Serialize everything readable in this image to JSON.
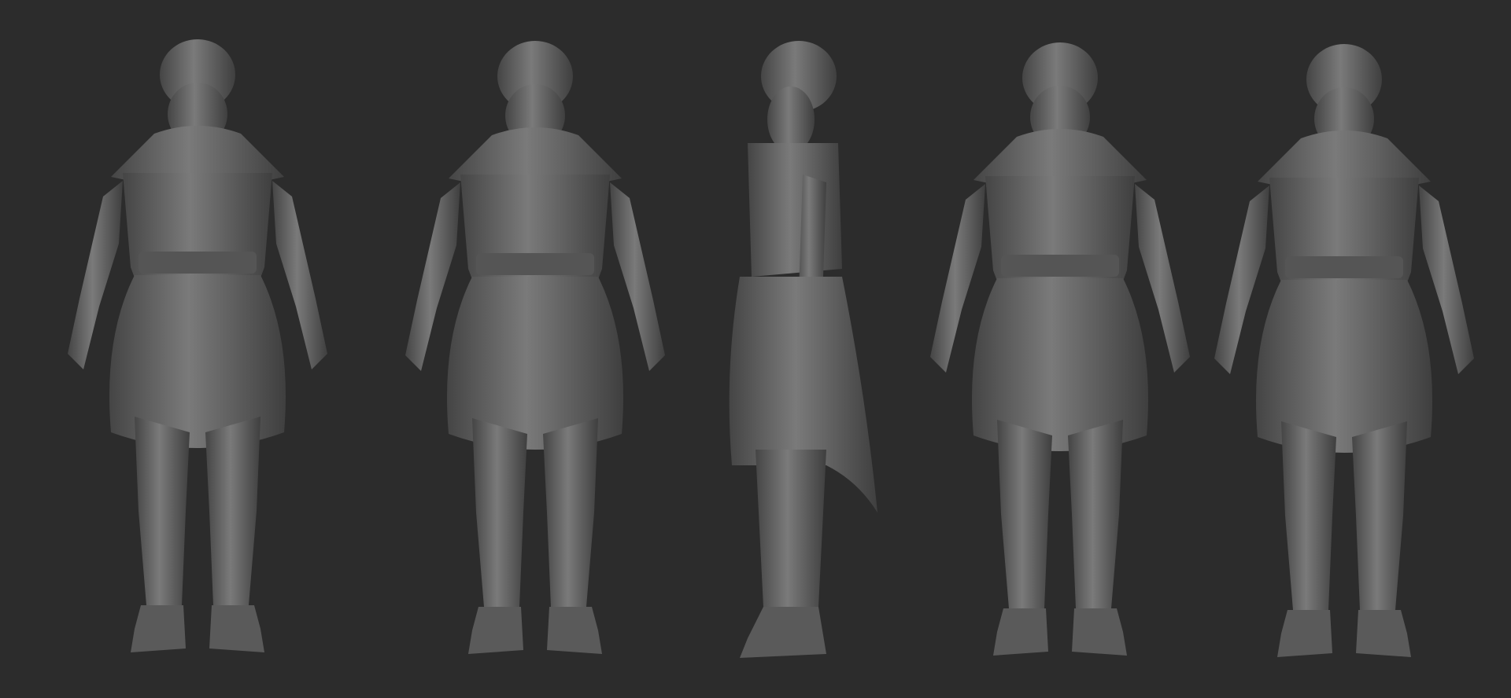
{
  "scene": {
    "background_color": "#2c2c2c",
    "model_color": "#6a6a6a",
    "model_shadow_color": "#3e3e3e",
    "model_highlight_color": "#8a8a8a",
    "views": [
      {
        "pose": "front"
      },
      {
        "pose": "back"
      },
      {
        "pose": "side"
      },
      {
        "pose": "three-quarter-front"
      },
      {
        "pose": "three-quarter-back"
      }
    ]
  }
}
